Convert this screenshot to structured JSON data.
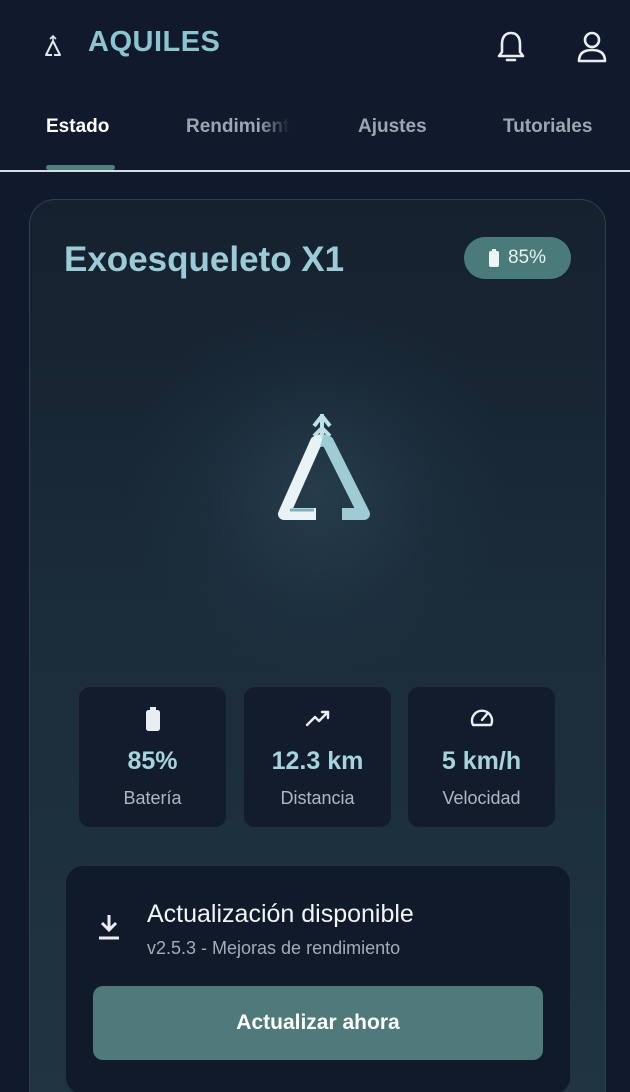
{
  "header": {
    "title": "AQUILES",
    "logo_icon": "aquiles-logo-icon",
    "notifications_icon": "bell-icon",
    "profile_icon": "user-icon"
  },
  "tabs": [
    {
      "label": "Estado",
      "active": true
    },
    {
      "label": "Rendimiento",
      "active": false
    },
    {
      "label": "Ajustes",
      "active": false
    },
    {
      "label": "Tutoriales",
      "active": false
    }
  ],
  "device": {
    "name": "Exoesqueleto X1",
    "battery_badge": "85%"
  },
  "stats": [
    {
      "icon": "battery-icon",
      "value": "85%",
      "label": "Batería"
    },
    {
      "icon": "trending-up-icon",
      "value": "12.3 km",
      "label": "Distancia"
    },
    {
      "icon": "speedometer-icon",
      "value": "5 km/h",
      "label": "Velocidad"
    }
  ],
  "update": {
    "icon": "download-icon",
    "title": "Actualización disponible",
    "subtitle": "v2.5.3 - Mejoras de rendimiento",
    "button_label": "Actualizar ahora"
  },
  "colors": {
    "background": "#101a2c",
    "accent": "#8fc3cf",
    "button": "#4f7a79",
    "active_tab_indicator": "#4f7f7f"
  }
}
